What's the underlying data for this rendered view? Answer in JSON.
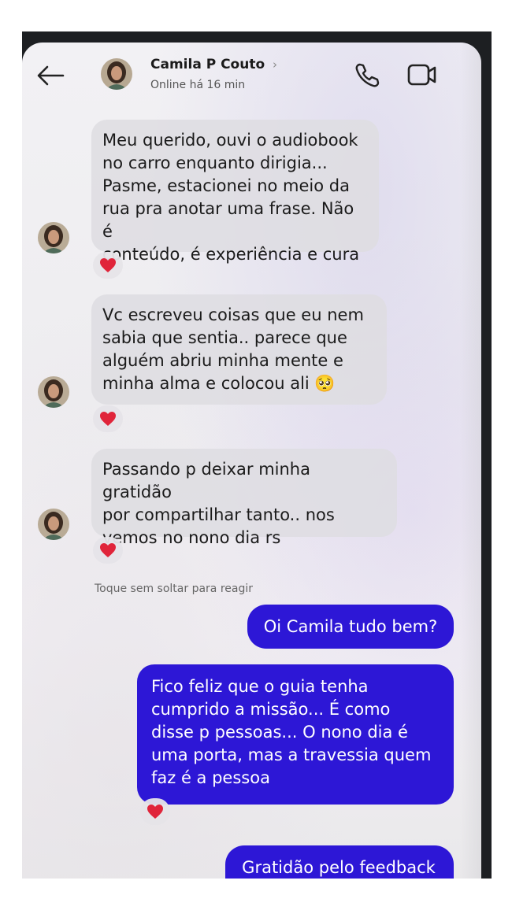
{
  "header": {
    "contact_name": "Camila P Couto",
    "chevron": "›",
    "status": "Online há 16 min",
    "back_icon": "arrow-left-icon",
    "call_icon": "phone-icon",
    "video_icon": "video-camera-icon"
  },
  "messages": [
    {
      "direction": "incoming",
      "text": "Meu querido, ouvi o audiobook\nno carro enquanto dirigia...\nPasme, estacionei no meio da\nrua pra anotar uma frase. Não é\nconteúdo, é experiência e cura",
      "reaction": "❤️"
    },
    {
      "direction": "incoming",
      "text": "Vc escreveu  coisas que eu nem\nsabia que sentia.. parece que\nalguém abriu minha mente e\nminha alma e colocou ali 🥺",
      "reaction": "❤️"
    },
    {
      "direction": "incoming",
      "text": "Passando p deixar minha gratidão\npor compartilhar tanto.. nos\nvemos no nono dia rs",
      "reaction": "❤️"
    },
    {
      "direction": "outgoing",
      "text": "Oi Camila tudo bem?"
    },
    {
      "direction": "outgoing",
      "text": "Fico feliz que o guia tenha\ncumprido a missão... É como\ndisse p pessoas... O nono dia é\numa porta, mas a travessia quem\nfaz é a pessoa",
      "reaction": "❤️"
    },
    {
      "direction": "outgoing",
      "text": "Gratidão pelo feedback"
    }
  ],
  "hint": "Toque sem soltar para reagir",
  "colors": {
    "outgoing_bubble": "#2d17d6",
    "incoming_bubble": "#dedde1",
    "reaction_heart": "#e0243a"
  }
}
